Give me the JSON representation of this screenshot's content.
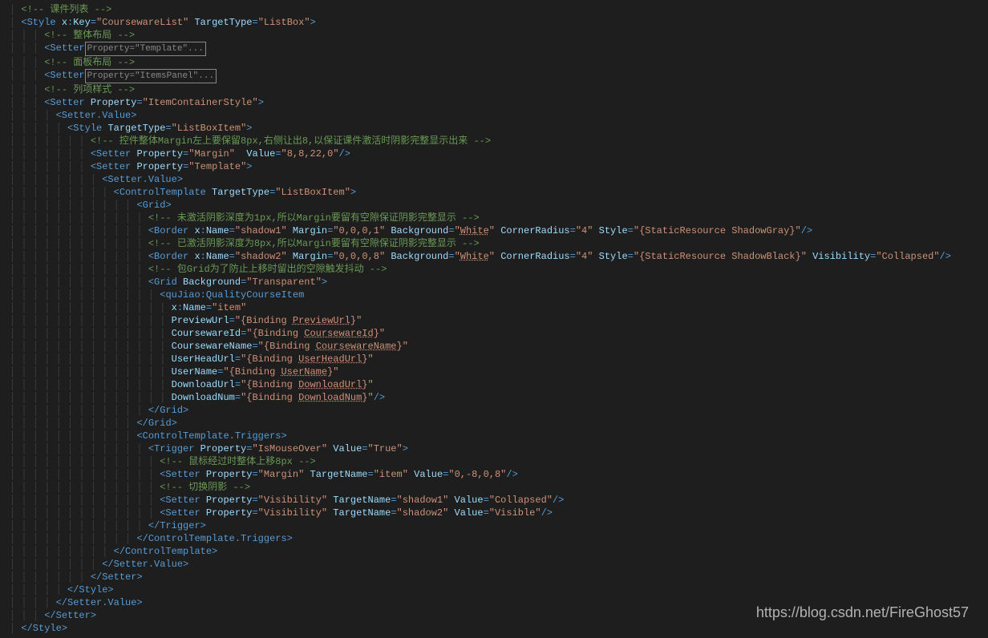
{
  "watermark": "https://blog.csdn.net/FireGhost57",
  "comments": {
    "c1": " 课件列表 ",
    "c2": " 整体布局 ",
    "c3": " 面板布局 ",
    "c4": " 列项样式 ",
    "c5": " 控件整体Margin左上要保留8px,右侧让出8,以保证课件激活时阴影完整显示出来 ",
    "c6": " 未激活阴影深度为1px,所以Margin要留有空隙保证阴影完整显示 ",
    "c7": " 已激活阴影深度为8px,所以Margin要留有空隙保证阴影完整显示 ",
    "c8": " 包Grid为了防止上移时留出的空隙触发抖动 ",
    "c9": " 鼠标经过时整体上移8px ",
    "c10": " 切换阴影 "
  },
  "style": {
    "key": "CoursewareList",
    "targetType": "ListBox"
  },
  "collapsed1": "Property=\"Template\"...",
  "collapsed2": "Property=\"ItemsPanel\"...",
  "setter3": {
    "property": "ItemContainerStyle"
  },
  "innerStyle": {
    "targetType": "ListBoxItem"
  },
  "marginSetter": {
    "property": "Margin",
    "value": "8,8,22,0"
  },
  "templateSetter": {
    "property": "Template"
  },
  "controlTemplate": {
    "targetType": "ListBoxItem"
  },
  "border1": {
    "name": "shadow1",
    "margin": "0,0,0,1",
    "background": "White",
    "cornerRadius": "4",
    "style": "{StaticResource ShadowGray}"
  },
  "border2": {
    "name": "shadow2",
    "margin": "0,0,0,8",
    "background": "White",
    "cornerRadius": "4",
    "style": "{StaticResource ShadowBlack}",
    "visibility": "Collapsed"
  },
  "gridBg": "Transparent",
  "item": {
    "tagName": "quJiao:QualityCourseItem",
    "name": "item",
    "previewUrl": "{Binding PreviewUrl}",
    "previewUrlMember": "PreviewUrl",
    "coursewareId": "{Binding CoursewareId}",
    "coursewareIdMember": "CoursewareId",
    "coursewareName": "{Binding CoursewareName}",
    "coursewareNameMember": "CoursewareName",
    "userHeadUrl": "{Binding UserHeadUrl}",
    "userHeadUrlMember": "UserHeadUrl",
    "userName": "{Binding UserName}",
    "userNameMember": "UserName",
    "downloadUrl": "{Binding DownloadUrl}",
    "downloadUrlMember": "DownloadUrl",
    "downloadNum": "{Binding DownloadNum}",
    "downloadNumMember": "DownloadNum"
  },
  "trigger": {
    "property": "IsMouseOver",
    "value": "True"
  },
  "triggerSetter1": {
    "property": "Margin",
    "targetName": "item",
    "value": "0,-8,0,8"
  },
  "triggerSetter2": {
    "property": "Visibility",
    "targetName": "shadow1",
    "value": "Collapsed"
  },
  "triggerSetter3": {
    "property": "Visibility",
    "targetName": "shadow2",
    "value": "Visible"
  }
}
